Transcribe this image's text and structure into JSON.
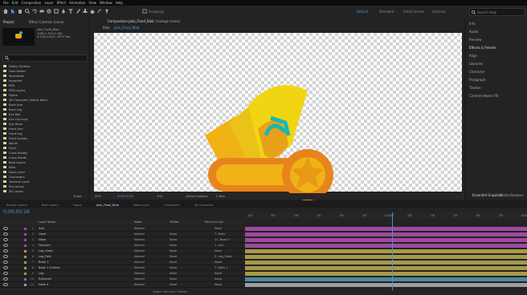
{
  "menu": [
    "File",
    "Edit",
    "Composition",
    "Layer",
    "Effect",
    "Animation",
    "View",
    "Window",
    "Help"
  ],
  "toolbar": {
    "snapping": "Snapping",
    "workspaces": [
      "Default",
      "Standard",
      "Small Screen",
      "Libraries"
    ],
    "active_workspace": "Default",
    "search_placeholder": "Search Help"
  },
  "project_panel": {
    "tabs": [
      "Project",
      "Effect Controls (none)"
    ],
    "thumb_info": [
      "Jake_Fixed_Blob",
      "1280 x 720 (1.00)",
      "Δ 0;00;10;00, 29.97 fps"
    ],
    "search_value": "",
    "items": [
      {
        "label": "Dobby Studios",
        "color": "#d8d4a0"
      },
      {
        "label": "Hole Holder",
        "color": "#d8d4a0"
      },
      {
        "label": "Illustration",
        "color": "#d8d4a0"
      },
      {
        "label": "Imported",
        "color": "#d8d4a0"
      },
      {
        "label": "PSD",
        "color": "#d8d4a0"
      },
      {
        "label": "PSD Layers",
        "color": "#d8d4a0"
      },
      {
        "label": "Figure",
        "color": "#d8d4a0"
      },
      {
        "label": "3D Character (Yellow Blob)",
        "color": "#d8d4a0"
      },
      {
        "label": "Back Arm",
        "color": "#d8d4a0"
      },
      {
        "label": "Back Leg",
        "color": "#d8d4a0"
      },
      {
        "label": "Eye Ball",
        "color": "#d8d4a0"
      },
      {
        "label": "Eye Lid Layer",
        "color": "#d8d4a0"
      },
      {
        "label": "Eye Brow",
        "color": "#d8d4a0"
      },
      {
        "label": "Front Arm",
        "color": "#d8d4a0"
      },
      {
        "label": "Front Leg",
        "color": "#d8d4a0"
      },
      {
        "label": "Front Eyelids",
        "color": "#d8d4a0"
      },
      {
        "label": "Mouth",
        "color": "#d8d4a0"
      },
      {
        "label": "Pupil",
        "color": "#d8d4a0"
      },
      {
        "label": "Cross Blobby",
        "color": "#d8d4a0"
      },
      {
        "label": "Cross Seeds",
        "color": "#d8d4a0"
      },
      {
        "label": "Blob Layers",
        "color": "#d8d4a0"
      },
      {
        "label": "Blob",
        "color": "#d8d4a0"
      },
      {
        "label": "Nose Layer",
        "color": "#d8d4a0"
      },
      {
        "label": "Characters",
        "color": "#d8d4a0"
      },
      {
        "label": "Tentacle Layer",
        "color": "#d8d4a0"
      },
      {
        "label": "Pre-comps",
        "color": "#d8d4a0"
      },
      {
        "label": "3D Layers",
        "color": "#d8d4a0"
      }
    ],
    "bpc": "8 bpc"
  },
  "comp_panel": {
    "tabs": [
      "Composition Jake_Fixed_Blob",
      "Footage (none)"
    ],
    "breadcrumb": [
      "Blob",
      "Jake_Fixed_Blob"
    ],
    "zoom": "50%",
    "timecode": "0;00;00;16",
    "resolution": "Full",
    "camera": "Active Camera",
    "views": "1 View"
  },
  "right_panel": {
    "items": [
      "Info",
      "Audio",
      "Preview",
      "Effects & Presets",
      "Align",
      "Libraries",
      "Character",
      "Paragraph",
      "Tracker",
      "Content-Aware Fill"
    ]
  },
  "lower_right_tabs": [
    "Essential Graphics",
    "Media Browser"
  ],
  "timeline": {
    "tabs": [
      "Render Queue",
      "Blob Layers",
      "Figure",
      "Jake_Fixed_Blob",
      "Nose Layer",
      "Characters",
      "3D Character"
    ],
    "active_tab": "Jake_Fixed_Blob",
    "timecode": "0;00;00;16",
    "columns": {
      "name": "Layer Name",
      "mode": "Mode",
      "trkmat": "TrkMat",
      "parent": "Parent & Link"
    },
    "layers": [
      {
        "num": "1",
        "name": "Arm",
        "mode": "Normal",
        "trkmat": "",
        "parent": "None",
        "color": "#9e4a9e"
      },
      {
        "num": "2",
        "name": "Hand",
        "mode": "Normal",
        "trkmat": "None",
        "parent": "7. Body",
        "color": "#9e4a9e"
      },
      {
        "num": "3",
        "name": "Nose",
        "mode": "Normal",
        "trkmat": "None",
        "parent": "11. Nose 4",
        "color": "#9e4a9e"
      },
      {
        "num": "4",
        "name": "Forearm",
        "mode": "Normal",
        "trkmat": "None",
        "parent": "1. Arm",
        "color": "#9e4a9e"
      },
      {
        "num": "5",
        "name": "Leg_Fixed",
        "mode": "Normal",
        "trkmat": "None",
        "parent": "None",
        "color": "#a59a4a"
      },
      {
        "num": "6",
        "name": "Leg_Pole",
        "mode": "Normal",
        "trkmat": "None",
        "parent": "5. Leg_Fixed",
        "color": "#a59a4a"
      },
      {
        "num": "7",
        "name": "Body 1",
        "mode": "Normal",
        "trkmat": "None",
        "parent": "None",
        "color": "#a59a4a"
      },
      {
        "num": "8",
        "name": "Body 1 Outline",
        "mode": "Normal",
        "trkmat": "None",
        "parent": "7. Body 1",
        "color": "#a59a4a"
      },
      {
        "num": "9",
        "name": "Leg",
        "mode": "Normal",
        "trkmat": "None",
        "parent": "None",
        "color": "#a59a4a"
      },
      {
        "num": "10",
        "name": "Extender",
        "mode": "Normal",
        "trkmat": "None",
        "parent": "None",
        "color": "#4a8a9e"
      },
      {
        "num": "11",
        "name": "Nose 4",
        "mode": "Normal",
        "trkmat": "None",
        "parent": "None",
        "color": "#9e9e9e"
      }
    ],
    "ruler": [
      "01f",
      "05f",
      "10f",
      "15f",
      "20f",
      "25f",
      "01:00f",
      "05f",
      "10f",
      "15f",
      "20f",
      "25f",
      "02:00f"
    ],
    "playhead_fraction": 0.52,
    "footer": "Toggle Switches / Modes"
  }
}
